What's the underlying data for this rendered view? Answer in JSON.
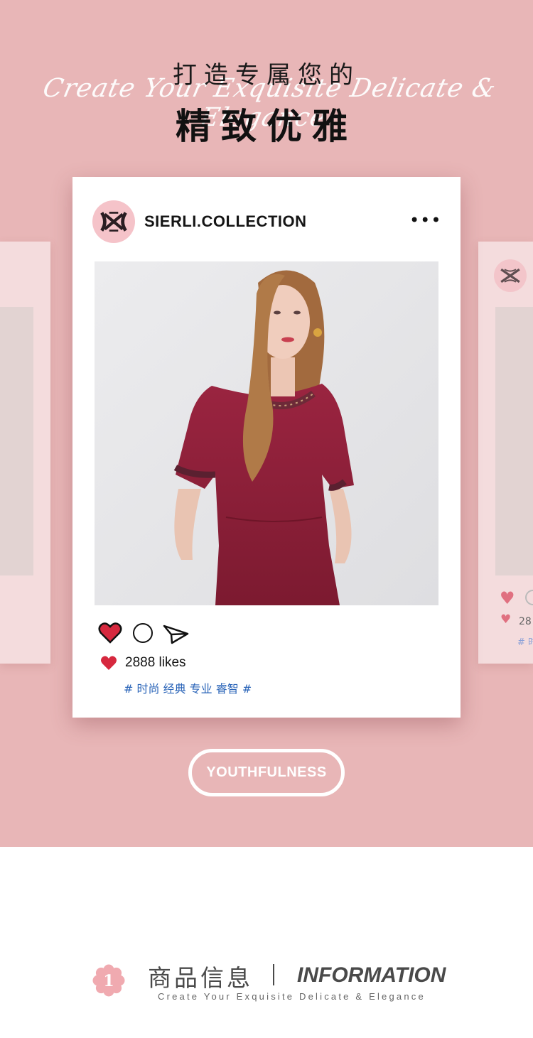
{
  "header": {
    "title_top": "打造专属您的",
    "script_line": "Create Your Exquisite Delicate & Elegance",
    "title_main": "精致优雅"
  },
  "post": {
    "logo_icon": "brand-monogram-icon",
    "account": "SIERLI.COLLECTION",
    "more_label": "•••",
    "photo_alt": "model-in-burgundy-dress",
    "likes": "2888 likes",
    "tags": "# 时尚 经典 专业 睿智 #"
  },
  "side_card_right": {
    "likes_partial": "28",
    "tags_partial": "# 时"
  },
  "badge": {
    "label": "YOUTHFULNESS"
  },
  "info": {
    "number": "1",
    "title_cn": "商品信息",
    "separator": "|",
    "title_en": "INFORMATION",
    "subtitle": "Create Your Exquisite Delicate & Elegance"
  },
  "colors": {
    "background_pink": "#e8b6b7",
    "heart_red": "#d6283e",
    "tag_blue": "#2a64b8",
    "badge_pink": "#f0aab0",
    "burgundy": "#8a1f34"
  }
}
